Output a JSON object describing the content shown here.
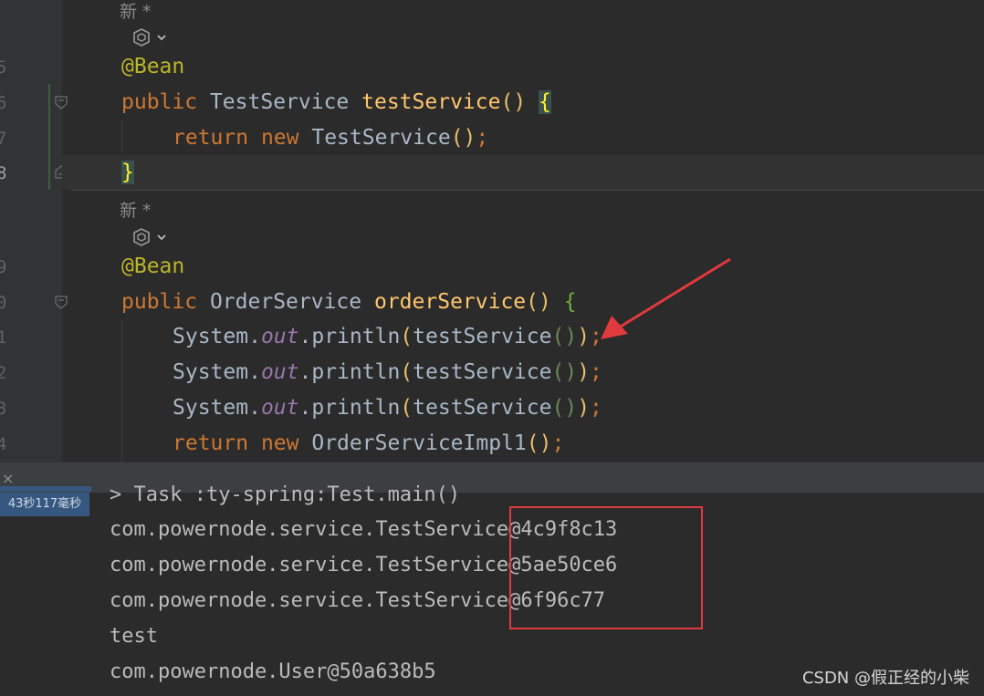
{
  "gutter": {
    "line_numbers": [
      "5",
      "6",
      "7",
      "8",
      "9",
      "0",
      "1",
      "2",
      "3",
      "4"
    ]
  },
  "hints": {
    "new_label_1": "新 *",
    "new_label_2": "新 *"
  },
  "code": {
    "annotation": "@Bean",
    "block1": {
      "kw_public": "public",
      "type": "TestService",
      "method": "testService",
      "parens": "()",
      "brace_open": "{",
      "kw_return": "return",
      "kw_new": "new",
      "ctor": "TestService",
      "ctor_parens": "()",
      "semi": ";",
      "brace_close": "}"
    },
    "block2": {
      "kw_public": "public",
      "type": "OrderService",
      "method": "orderService",
      "parens": "()",
      "brace_open": "{",
      "system": "System",
      "dot1": ".",
      "field_out": "out",
      "dot2": ".",
      "println": "println",
      "lp": "(",
      "call": "testService",
      "call_parens": "()",
      "rp": ")",
      "semi": ";",
      "kw_return": "return",
      "kw_new": "new",
      "ctor": "OrderServiceImpl1",
      "ctor_parens": "()"
    }
  },
  "run": {
    "timer": "43秒117毫秒",
    "close": "×"
  },
  "console": {
    "lines": [
      "> Task :ty-spring:Test.main()",
      "com.powernode.service.TestService@4c9f8c13",
      "com.powernode.service.TestService@5ae50ce6",
      "com.powernode.service.TestService@6f96c77",
      "test",
      "com.powernode.User@50a638b5"
    ]
  },
  "watermark": "CSDN @假正经的小柴",
  "colors": {
    "keyword": "#cc7832",
    "annotation": "#bbb529",
    "method": "#ffc66d",
    "field": "#9876aa",
    "text": "#a9b7c6",
    "highlight_box": "#e0393e",
    "arrow": "#e0393e"
  }
}
